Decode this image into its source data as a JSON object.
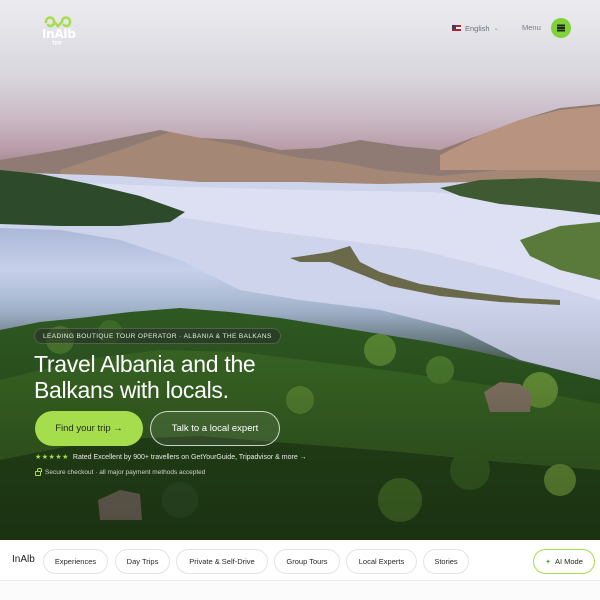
{
  "header": {
    "logo_text": "InAlb",
    "logo_sub": "TPP",
    "language": "English",
    "menu_label": "Menu",
    "flag_icon": "us-flag-icon",
    "accent_color": "#a6dd4c"
  },
  "hero": {
    "tagline": "LEADING BOUTIQUE TOUR OPERATOR · ALBANIA & THE BALKANS",
    "headline": "Travel Albania and the Balkans with locals.",
    "primary_cta": "Find your trip →",
    "secondary_cta": "Talk to a local expert",
    "rating_stars": "★★★★★",
    "rating_text": "Rated Excellent by 900+ travellers on GetYourGuide, Tripadvisor & more →",
    "secure_text": "Secure checkout · all major payment methods accepted"
  },
  "bottom_nav": {
    "brand": "InAlb",
    "items": [
      {
        "label": "Experiences"
      },
      {
        "label": "Day Trips"
      },
      {
        "label": "Private & Self-Drive"
      },
      {
        "label": "Group Tours"
      },
      {
        "label": "Local Experts"
      },
      {
        "label": "Stories"
      }
    ],
    "ai_mode": "AI Mode"
  }
}
